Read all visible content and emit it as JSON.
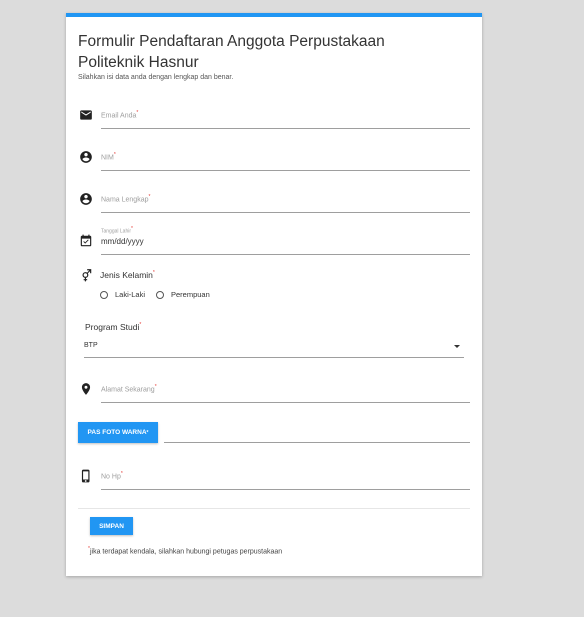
{
  "form": {
    "title": "Formulir Pendaftaran Anggota Perpustakaan Politeknik Hasnur",
    "subtitle": "Silahkan isi data anda dengan lengkap dan benar.",
    "required_mark": "*",
    "fields": {
      "email": {
        "placeholder": "Email Anda",
        "icon": "email-icon"
      },
      "nim": {
        "placeholder": "NIM",
        "icon": "account-circle-icon"
      },
      "nama": {
        "placeholder": "Nama Lengkap",
        "icon": "account-circle-icon"
      },
      "tanggal_lahir": {
        "label": "Tanggal Lahir",
        "value": "mm/dd/yyyy",
        "icon": "calendar-icon"
      },
      "alamat": {
        "placeholder": "Alamat Sekarang",
        "icon": "location-pin-icon"
      },
      "no_hp": {
        "placeholder": "No Hp",
        "icon": "phone-icon"
      }
    },
    "gender": {
      "label": "Jenis Kelamin",
      "icon": "gender-icon",
      "options": [
        "Laki-Laki",
        "Perempuan"
      ]
    },
    "program_studi": {
      "label": "Program Studi",
      "selected": "BTP"
    },
    "pas_foto_button": "PAS FOTO WARNA",
    "submit_button": "SIMPAN",
    "note": "jika terdapat kendala, silahkan hubungi petugas perpustakaan"
  },
  "colors": {
    "accent": "#2196f3",
    "background": "#dcdcdc",
    "required": "#e53935"
  }
}
